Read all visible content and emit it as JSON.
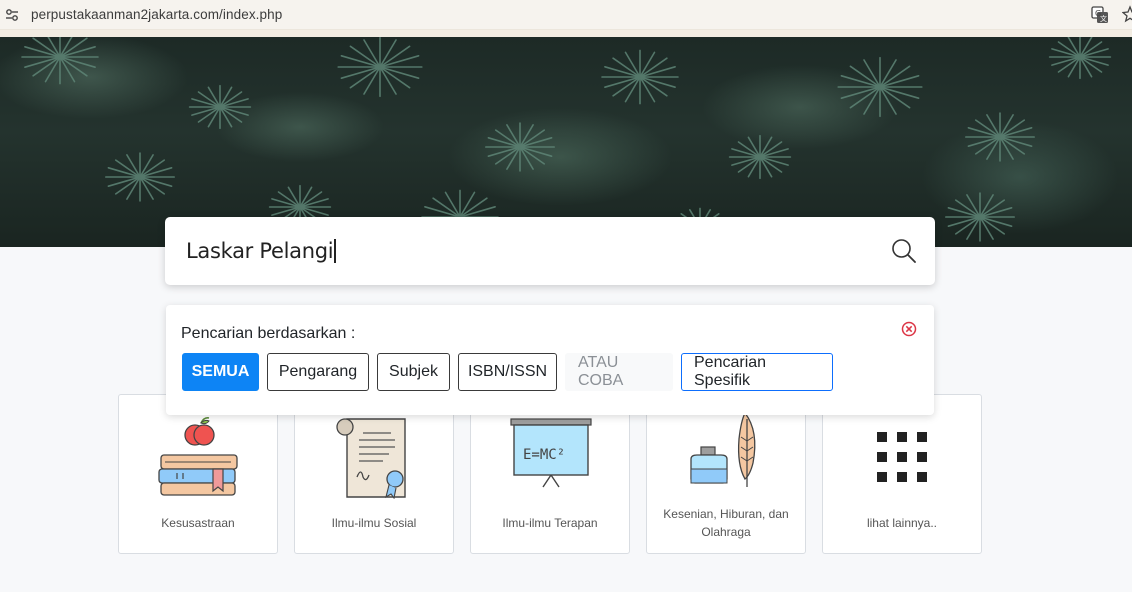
{
  "browser": {
    "url": "perpustakaanman2jakarta.com/index.php"
  },
  "search": {
    "query": "Laskar Pelangi"
  },
  "filter": {
    "heading": "Pencarian berdasarkan :",
    "buttons": [
      "SEMUA",
      "Pengarang",
      "Subjek",
      "ISBN/ISSN",
      "ATAU COBA",
      "Pencarian Spesifik"
    ]
  },
  "categories": [
    {
      "label": "Kesusastraan"
    },
    {
      "label": "Ilmu-ilmu Sosial"
    },
    {
      "label": "Ilmu-ilmu Terapan",
      "board_text": "E=MC²"
    },
    {
      "label": "Kesenian, Hiburan, dan Olahraga"
    },
    {
      "label": "lihat lainnya.."
    }
  ],
  "colors": {
    "primary": "#0d84f5",
    "close_icon": "#dc3545"
  }
}
